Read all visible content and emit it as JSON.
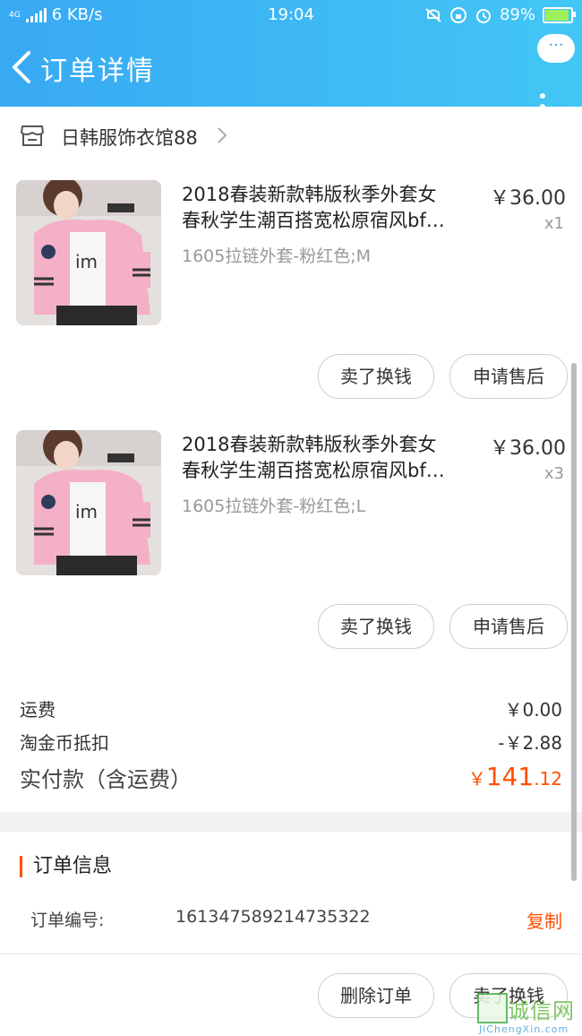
{
  "status_bar": {
    "network_badge": "4G",
    "speed": "6 KB/s",
    "time": "19:04",
    "battery": "89%",
    "battery_level": 0.89,
    "icons": [
      "signal-icon",
      "mute-icon",
      "lock-rotation-icon",
      "alarm-icon",
      "battery-icon"
    ]
  },
  "header": {
    "title": "订单详情",
    "more_label": "···",
    "back_icon": "chevron-left-icon"
  },
  "shop": {
    "name": "日韩服饰衣馆88",
    "icon": "store-icon"
  },
  "items": [
    {
      "title_line1": "2018春装新款韩版秋季外套女",
      "title_line2": "春秋学生潮百搭宽松原宿风bf…",
      "price": "￥36.00",
      "qty": "x1",
      "sku": "1605拉链外套-粉红色;M",
      "actions": [
        "卖了换钱",
        "申请售后"
      ]
    },
    {
      "title_line1": "2018春装新款韩版秋季外套女",
      "title_line2": "春秋学生潮百搭宽松原宿风bf…",
      "price": "￥36.00",
      "qty": "x3",
      "sku": "1605拉链外套-粉红色;L",
      "actions": [
        "卖了换钱",
        "申请售后"
      ]
    }
  ],
  "fees": {
    "shipping_label": "运费",
    "shipping_value": "￥0.00",
    "coin_label": "淘金币抵扣",
    "coin_value": "-￥2.88"
  },
  "total": {
    "label": "实付款（含运费）",
    "currency": "￥",
    "integer": "141",
    "decimal": ".12"
  },
  "order_info": {
    "section_title": "订单信息",
    "number_label": "订单编号:",
    "number_value": "161347589214735322",
    "copy_label": "复制"
  },
  "bottom_actions": [
    "删除订单",
    "卖了换钱"
  ],
  "watermark": {
    "text": "诚信网",
    "sub": "JiChengXin.com"
  },
  "colors": {
    "header": "#38a9f3",
    "accent": "#ff5000"
  }
}
